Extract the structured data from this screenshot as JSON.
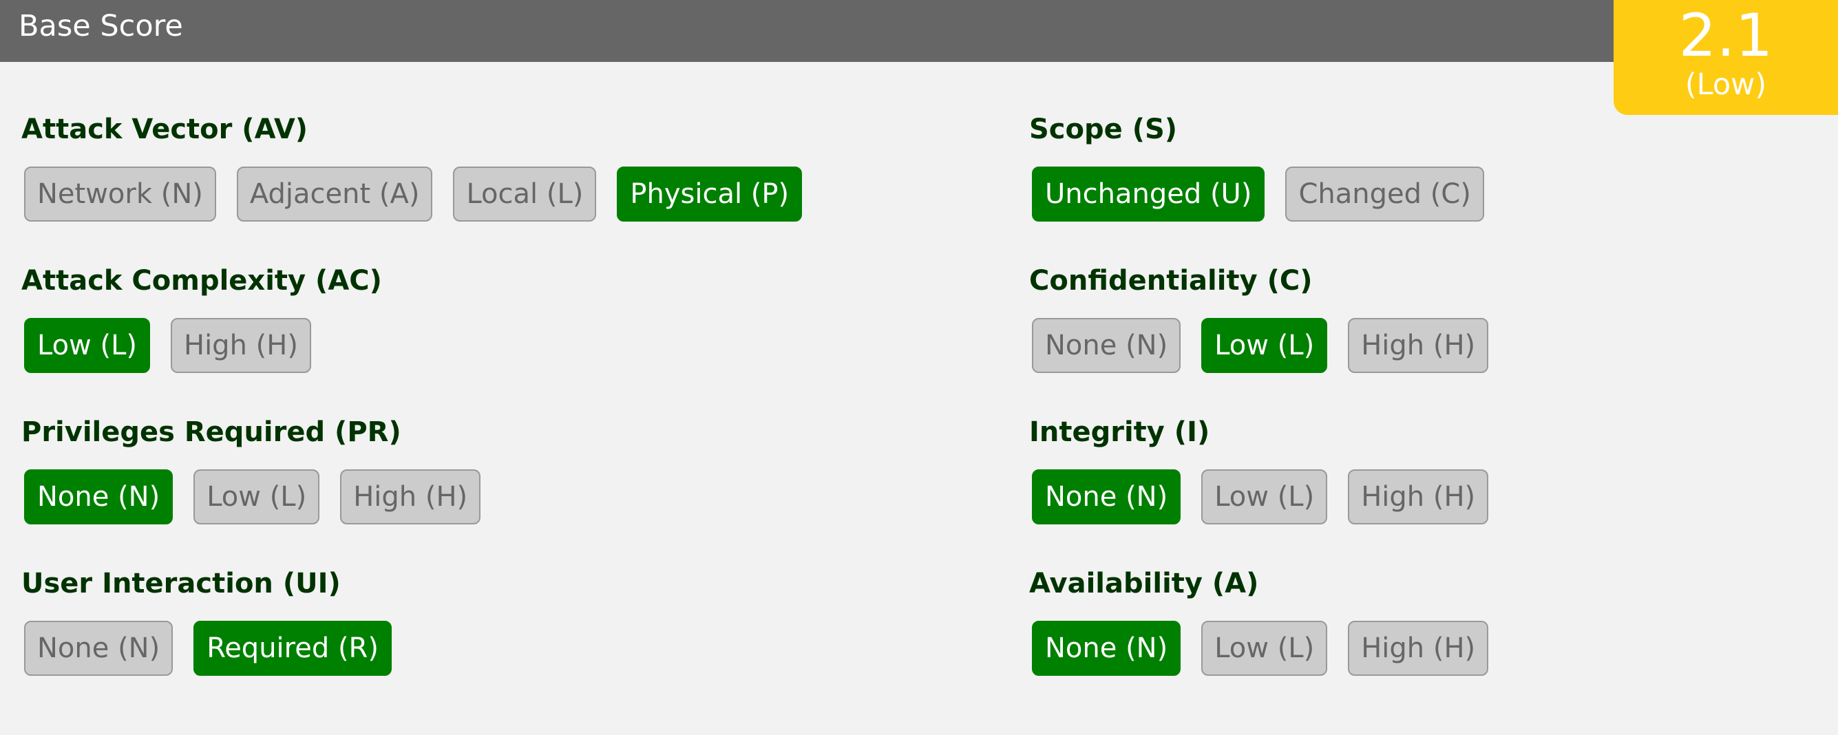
{
  "header": {
    "title": "Base Score"
  },
  "score": {
    "value": "2.1",
    "rating": "(Low)"
  },
  "metrics": {
    "attack_vector": {
      "label": "Attack Vector (AV)",
      "options": [
        "Network (N)",
        "Adjacent (A)",
        "Local (L)",
        "Physical (P)"
      ],
      "selected": 3
    },
    "attack_complexity": {
      "label": "Attack Complexity (AC)",
      "options": [
        "Low (L)",
        "High (H)"
      ],
      "selected": 0
    },
    "privileges_required": {
      "label": "Privileges Required (PR)",
      "options": [
        "None (N)",
        "Low (L)",
        "High (H)"
      ],
      "selected": 0
    },
    "user_interaction": {
      "label": "User Interaction (UI)",
      "options": [
        "None (N)",
        "Required (R)"
      ],
      "selected": 1
    },
    "scope": {
      "label": "Scope (S)",
      "options": [
        "Unchanged (U)",
        "Changed (C)"
      ],
      "selected": 0
    },
    "confidentiality": {
      "label": "Confidentiality (C)",
      "options": [
        "None (N)",
        "Low (L)",
        "High (H)"
      ],
      "selected": 1
    },
    "integrity": {
      "label": "Integrity (I)",
      "options": [
        "None (N)",
        "Low (L)",
        "High (H)"
      ],
      "selected": 0
    },
    "availability": {
      "label": "Availability (A)",
      "options": [
        "None (N)",
        "Low (L)",
        "High (H)"
      ],
      "selected": 0
    }
  },
  "colors": {
    "header_bg": "#666666",
    "score_bg": "#fecc13",
    "selected_bg": "#008000",
    "unselected_bg": "#cccccc",
    "label_text": "#003300"
  }
}
